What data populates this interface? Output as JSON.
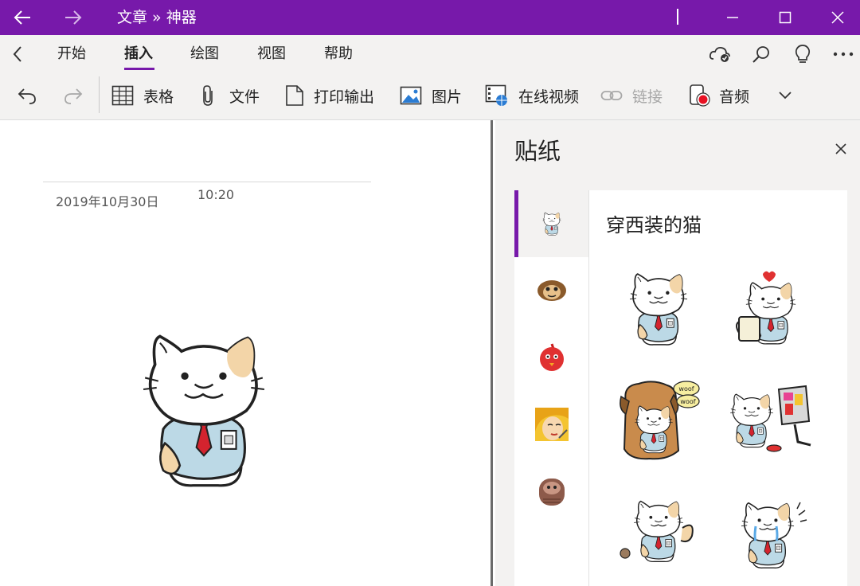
{
  "titlebar": {
    "title": "文章 » 神器"
  },
  "menu": {
    "tabs": [
      "开始",
      "插入",
      "绘图",
      "视图",
      "帮助"
    ],
    "active_index": 1
  },
  "ribbon": {
    "table": "表格",
    "file": "文件",
    "printout": "打印输出",
    "picture": "图片",
    "online_video": "在线视频",
    "link": "链接",
    "audio": "音频"
  },
  "page": {
    "date": "2019年10月30日",
    "time": "10:20"
  },
  "stickers_panel": {
    "title": "贴纸",
    "categories": [
      {
        "icon": "business-cat-icon",
        "active": true
      },
      {
        "icon": "monkey-icon",
        "active": false
      },
      {
        "icon": "red-bird-icon",
        "active": false
      },
      {
        "icon": "pop-art-woman-icon",
        "active": false
      },
      {
        "icon": "sloth-icon",
        "active": false
      }
    ],
    "category_title": "穿西装的猫",
    "stickers": [
      {
        "icon": "cat-sitting-sticker"
      },
      {
        "icon": "cat-coffee-heart-sticker"
      },
      {
        "icon": "cat-dog-costume-sticker"
      },
      {
        "icon": "cat-computer-sticker"
      },
      {
        "icon": "cat-kicking-sticker"
      },
      {
        "icon": "cat-crying-sticker"
      }
    ],
    "bubble_text": [
      "woof",
      "woof"
    ]
  },
  "colors": {
    "brand": "#7719aa",
    "ribbon_bg": "#f3f2f1",
    "cat_tie": "#d3232e",
    "cat_shirt": "#bcd9e6",
    "cat_patch": "#f3d5a8"
  }
}
